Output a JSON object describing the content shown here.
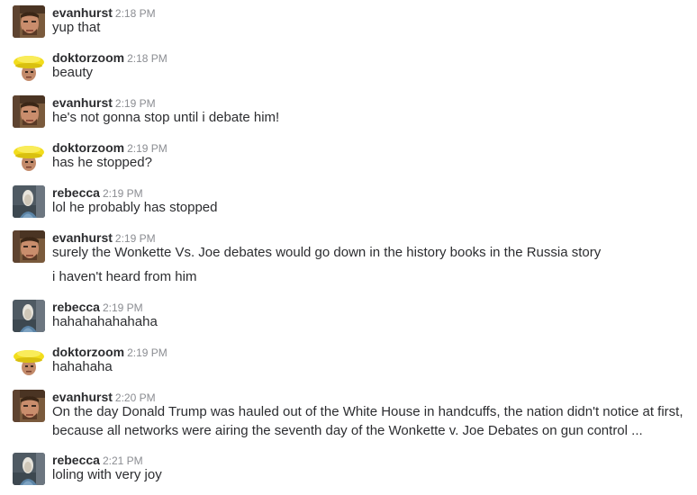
{
  "messages": [
    {
      "author": "evanhurst",
      "time": "2:18 PM",
      "avatar": "evanhurst-avatar",
      "lines": [
        "yup that"
      ]
    },
    {
      "author": "doktorzoom",
      "time": "2:18 PM",
      "avatar": "doktorzoom-avatar",
      "lines": [
        "beauty"
      ]
    },
    {
      "author": "evanhurst",
      "time": "2:19 PM",
      "avatar": "evanhurst-avatar",
      "lines": [
        "he's not gonna stop until i debate him!"
      ]
    },
    {
      "author": "doktorzoom",
      "time": "2:19 PM",
      "avatar": "doktorzoom-avatar",
      "lines": [
        "has he stopped?"
      ]
    },
    {
      "author": "rebecca",
      "time": "2:19 PM",
      "avatar": "rebecca-avatar",
      "lines": [
        "lol he probably has stopped"
      ]
    },
    {
      "author": "evanhurst",
      "time": "2:19 PM",
      "avatar": "evanhurst-avatar",
      "lines": [
        "surely the Wonkette Vs. Joe debates would go down in the history books in the Russia story",
        "i haven't heard from him"
      ]
    },
    {
      "author": "rebecca",
      "time": "2:19 PM",
      "avatar": "rebecca-avatar",
      "lines": [
        "hahahahahahaha"
      ]
    },
    {
      "author": "doktorzoom",
      "time": "2:19 PM",
      "avatar": "doktorzoom-avatar",
      "lines": [
        "hahahaha"
      ]
    },
    {
      "author": "evanhurst",
      "time": "2:20 PM",
      "avatar": "evanhurst-avatar",
      "lines": [
        "On the day Donald Trump was hauled out of the White House in handcuffs, the nation didn't notice at first,",
        "because all networks were airing the seventh day of the Wonkette v. Joe Debates on gun control ..."
      ]
    },
    {
      "author": "rebecca",
      "time": "2:21 PM",
      "avatar": "rebecca-avatar",
      "lines": [
        "loling with very joy"
      ]
    }
  ]
}
